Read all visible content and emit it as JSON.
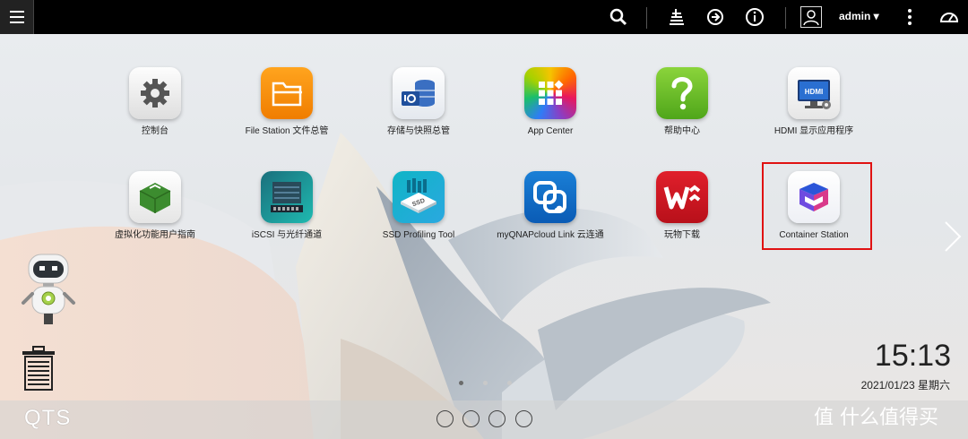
{
  "topbar": {
    "username": "admin ▾"
  },
  "apps": [
    {
      "label": "控制台"
    },
    {
      "label": "File Station 文件总管"
    },
    {
      "label": "存储与快照总管"
    },
    {
      "label": "App Center"
    },
    {
      "label": "帮助中心"
    },
    {
      "label": "HDMI 显示应用程序"
    },
    {
      "label": "虚拟化功能用户指南"
    },
    {
      "label": "iSCSI 与光纤通道"
    },
    {
      "label": "SSD Profiling Tool"
    },
    {
      "label": "myQNAPcloud Link 云连通"
    },
    {
      "label": "玩物下载"
    },
    {
      "label": "Container Station"
    }
  ],
  "tiles": {
    "hdmi": "HDMI",
    "ssd": "SSD"
  },
  "clock": {
    "time": "15:13",
    "date": "2021/01/23 星期六"
  },
  "bottom": {
    "logo": "QTS"
  },
  "watermark": "值 什么值得买",
  "colors": {
    "highlight": "#e01212",
    "topbar": "#000000"
  }
}
